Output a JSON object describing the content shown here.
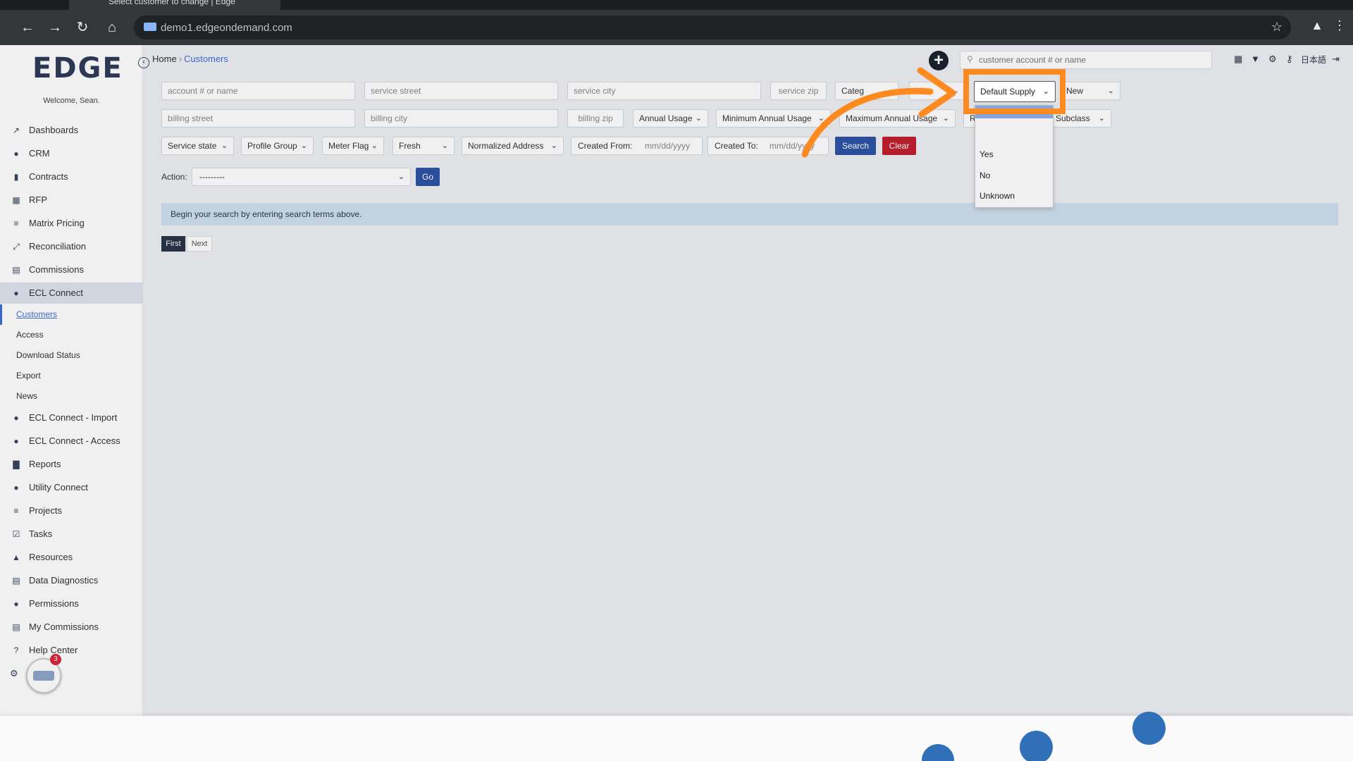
{
  "browser": {
    "tab_title": "Select customer to change | Edge",
    "url": "demo1.edgeondemand.com"
  },
  "app": {
    "logo_text": "EDGE",
    "welcome": "Welcome, Sean.",
    "notification_count": "3"
  },
  "sidebar": {
    "items": [
      {
        "label": "Dashboards",
        "icon": "chart-line-icon"
      },
      {
        "label": "CRM",
        "icon": "users-icon"
      },
      {
        "label": "Contracts",
        "icon": "file-icon"
      },
      {
        "label": "RFP",
        "icon": "sitemap-icon"
      },
      {
        "label": "Matrix Pricing",
        "icon": "list-icon"
      },
      {
        "label": "Reconciliation",
        "icon": "compress-icon"
      },
      {
        "label": "Commissions",
        "icon": "money-stack-icon"
      },
      {
        "label": "ECL Connect",
        "icon": "user-link-icon"
      },
      {
        "label": "ECL Connect - Import",
        "icon": "user-link-icon"
      },
      {
        "label": "ECL Connect - Access",
        "icon": "user-link-icon"
      },
      {
        "label": "Reports",
        "icon": "bar-chart-icon"
      },
      {
        "label": "Utility Connect",
        "icon": "plug-user-icon"
      },
      {
        "label": "Projects",
        "icon": "list-icon"
      },
      {
        "label": "Tasks",
        "icon": "tasks-icon"
      },
      {
        "label": "Resources",
        "icon": "folder-icon"
      },
      {
        "label": "Data Diagnostics",
        "icon": "server-icon"
      },
      {
        "label": "Permissions",
        "icon": "user-lock-icon"
      },
      {
        "label": "My Commissions",
        "icon": "money-stack-icon"
      },
      {
        "label": "Help Center",
        "icon": "question-icon"
      }
    ],
    "ecl_sub_items": [
      "Customers",
      "Access",
      "Download Status",
      "Export",
      "News"
    ]
  },
  "header": {
    "breadcrumb_home": "Home",
    "breadcrumb_sep": "›",
    "breadcrumb_current": "Customers",
    "search_placeholder": "customer account # or name",
    "lang": "日本語"
  },
  "filters": {
    "account_placeholder": "account # or name",
    "service_street_placeholder": "service street",
    "service_city_placeholder": "service city",
    "service_zip_placeholder": "service zip",
    "category": "Categ",
    "elec": "lec",
    "default_supply": "Default Supply",
    "new": "New",
    "billing_street_placeholder": "billing street",
    "billing_city_placeholder": "billing city",
    "billing_zip_placeholder": "billing zip",
    "annual_usage": "Annual Usage",
    "min_annual_usage": "Minimum Annual Usage",
    "max_annual_usage": "Maximum Annual Usage",
    "rate_prefix": "R",
    "subclass": "Subclass",
    "service_state": "Service state",
    "profile_group": "Profile Group",
    "meter_flag": "Meter Flag",
    "fresh": "Fresh",
    "normalized_address": "Normalized Address",
    "created_from_label": "Created From:",
    "created_from_value": "mm/dd/yyyy",
    "created_to_label": "Created To:",
    "created_to_value": "mm/dd/yyyy",
    "search_btn": "Search",
    "clear_btn": "Clear"
  },
  "actions": {
    "label": "Action:",
    "select_value": "---------",
    "go_btn": "Go"
  },
  "info_message": "Begin your search by entering search terms above.",
  "pager": {
    "first": "First",
    "next": "Next"
  },
  "dropdown_options": [
    "Yes",
    "No",
    "Unknown"
  ],
  "colors": {
    "annotation": "#ff8a1f",
    "primary": "#2e53a6",
    "danger": "#c0202f",
    "info": "#cfe0ef"
  }
}
